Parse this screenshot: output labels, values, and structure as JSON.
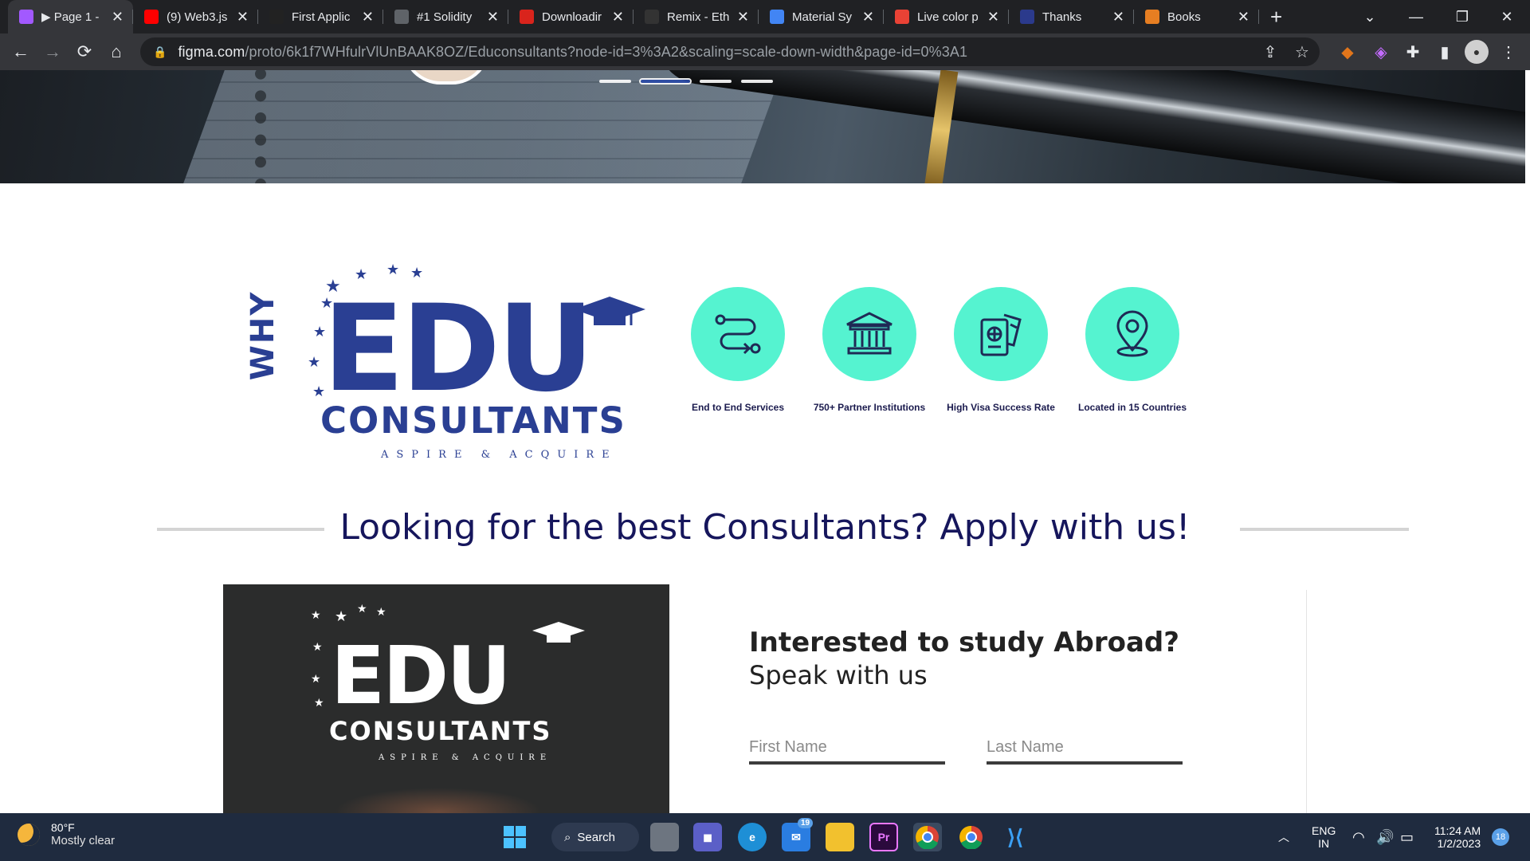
{
  "browser": {
    "tabs": [
      {
        "title": "▶ Page 1 -",
        "icon": "figma-icon",
        "color": "#a259ff",
        "active": true
      },
      {
        "title": "(9) Web3.js",
        "icon": "youtube-icon",
        "color": "#ff0000"
      },
      {
        "title": "First Applic",
        "icon": "dapp-icon",
        "color": "#222222"
      },
      {
        "title": "#1 Solidity",
        "icon": "globe-icon",
        "color": "#5f6368"
      },
      {
        "title": "Downloadir",
        "icon": "notion-icon",
        "color": "#d9241c"
      },
      {
        "title": "Remix - Eth",
        "icon": "github-icon",
        "color": "#333333"
      },
      {
        "title": "Material Sy",
        "icon": "material-icon",
        "color": "#4285f4"
      },
      {
        "title": "Live color p",
        "icon": "color-icon",
        "color": "#e94235"
      },
      {
        "title": "Thanks",
        "icon": "lad-icon",
        "color": "#2b3a8c"
      },
      {
        "title": "Books",
        "icon": "books-icon",
        "color": "#e67e22"
      }
    ],
    "url_host": "figma.com",
    "url_path": "/proto/6k1f7WHfulrVlUnBAAK8OZ/Educonsultants?node-id=3%3A2&scaling=scale-down-width&page-id=0%3A1"
  },
  "why": {
    "why_text": "WHY",
    "logo_main": "EDU",
    "logo_sub": "CONSULTANTS",
    "tagline": "ASPIRE & ACQUIRE"
  },
  "features": [
    {
      "label": "End to End Services",
      "icon": "route-icon"
    },
    {
      "label": "750+ Partner Institutions",
      "icon": "institution-icon"
    },
    {
      "label": "High Visa Success Rate",
      "icon": "passport-icon"
    },
    {
      "label": "Located in 15 Countries",
      "icon": "location-pin-icon"
    }
  ],
  "headline": "Looking for the best Consultants? Apply with us!",
  "card": {
    "logo_main": "EDU",
    "logo_sub": "CONSULTANTS",
    "tagline": "ASPIRE & ACQUIRE"
  },
  "form": {
    "title": "Interested to study Abroad?",
    "subtitle": "Speak with us",
    "first_name_placeholder": "First Name",
    "last_name_placeholder": "Last Name"
  },
  "taskbar": {
    "temperature": "80°F",
    "weather": "Mostly clear",
    "search_label": "Search",
    "mail_badge": "19",
    "lang_top": "ENG",
    "lang_bottom": "IN",
    "time": "11:24 AM",
    "date": "1/2/2023",
    "notif_count": "18"
  }
}
